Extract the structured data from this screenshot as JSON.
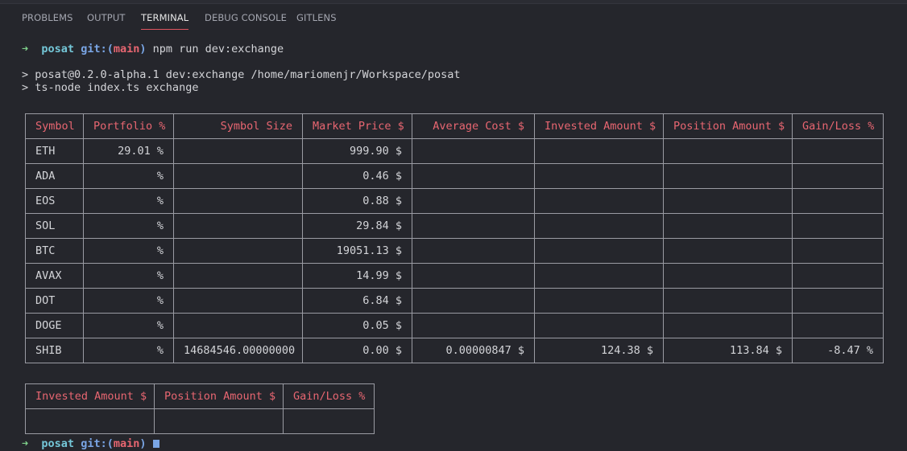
{
  "panel_tabs": [
    {
      "label": "PROBLEMS",
      "active": false
    },
    {
      "label": "OUTPUT",
      "active": false
    },
    {
      "label": "TERMINAL",
      "active": true
    },
    {
      "label": "DEBUG CONSOLE",
      "active": false
    },
    {
      "label": "GITLENS",
      "active": false
    }
  ],
  "prompt": {
    "arrow": "➜",
    "dir": "posat",
    "git_label": "git:(",
    "branch": "main",
    "git_close": ")",
    "command": "npm run dev:exchange"
  },
  "output_lines": [
    "> posat@0.2.0-alpha.1 dev:exchange /home/mariomenjr/Workspace/posat",
    "> ts-node index.ts exchange"
  ],
  "main_table": {
    "headers": [
      "Symbol",
      "Portfolio %",
      "Symbol Size",
      "Market Price $",
      "Average Cost $",
      "Invested Amount $",
      "Position Amount $",
      "Gain/Loss %"
    ],
    "rows": [
      [
        "ETH",
        "29.01 %",
        "",
        "999.90 $",
        "",
        "",
        "",
        ""
      ],
      [
        "ADA",
        "%",
        "",
        "0.46 $",
        "",
        "",
        "",
        ""
      ],
      [
        "EOS",
        "%",
        "",
        "0.88 $",
        "",
        "",
        "",
        ""
      ],
      [
        "SOL",
        "%",
        "",
        "29.84 $",
        "",
        "",
        "",
        ""
      ],
      [
        "BTC",
        "%",
        "",
        "19051.13 $",
        "",
        "",
        "",
        ""
      ],
      [
        "AVAX",
        "%",
        "",
        "14.99 $",
        "",
        "",
        "",
        ""
      ],
      [
        "DOT",
        "%",
        "",
        "6.84 $",
        "",
        "",
        "",
        ""
      ],
      [
        "DOGE",
        "%",
        "",
        "0.05 $",
        "",
        "",
        "",
        ""
      ],
      [
        "SHIB",
        "%",
        "14684546.00000000",
        "0.00 $",
        "0.00000847 $",
        "124.38 $",
        "113.84 $",
        "-8.47 %"
      ]
    ]
  },
  "summary_table": {
    "headers": [
      "Invested Amount $",
      "Position Amount $",
      "Gain/Loss %"
    ],
    "rows": [
      [
        "",
        "",
        ""
      ]
    ]
  },
  "last_prompt": {
    "arrow": "➜",
    "dir": "posat",
    "git_label": "git:(",
    "branch": "main",
    "git_close": ")"
  },
  "colors": {
    "background": "#25262c",
    "header_text": "#e86671",
    "active_tab_underline": "#e05561",
    "prompt_arrow": "#7fd18b",
    "prompt_dir": "#74c7d8"
  }
}
